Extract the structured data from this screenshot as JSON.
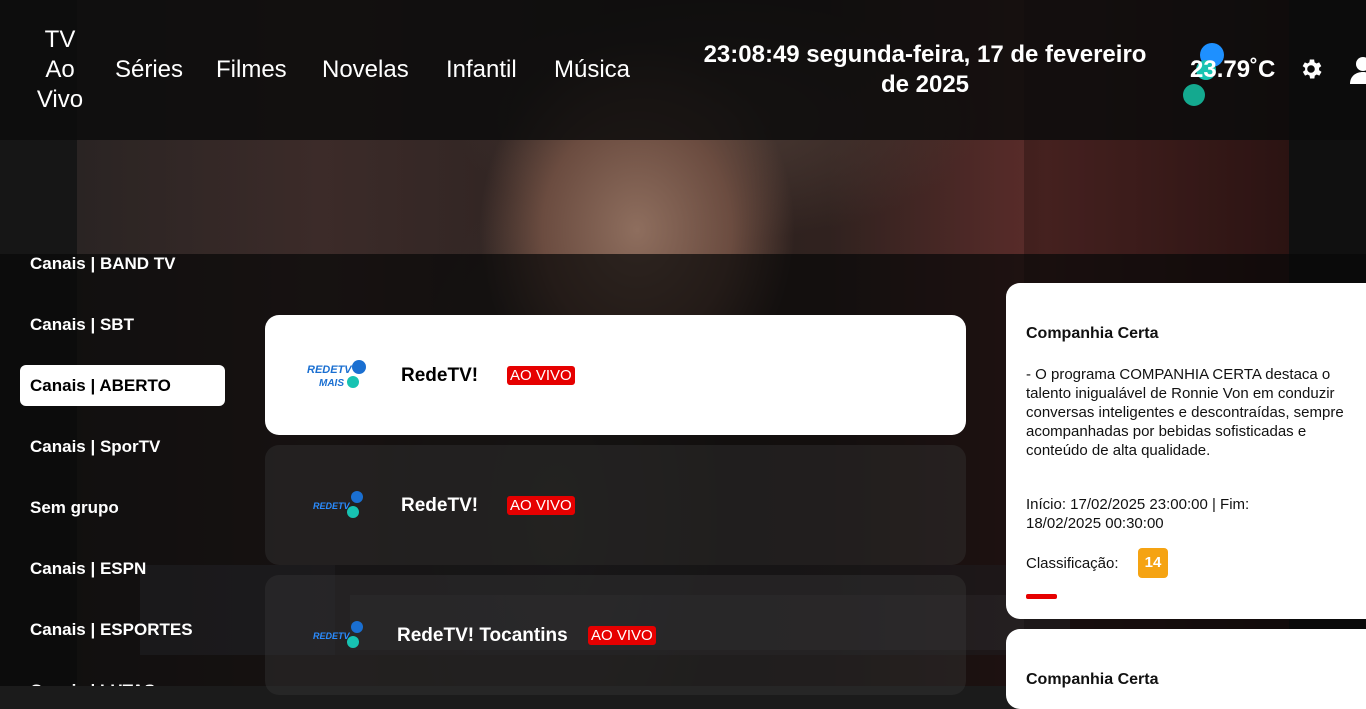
{
  "nav": {
    "tv_ao_vivo": [
      "TV",
      "Ao",
      "Vivo"
    ],
    "series": "Séries",
    "filmes": "Filmes",
    "novelas": "Novelas",
    "infantil": "Infantil",
    "musica": "Música"
  },
  "clock": {
    "line1": "23:08:49 segunda-feira, 17 de fevereiro",
    "line2": "de 2025"
  },
  "weather": {
    "temperature": "23.79˚C",
    "icon": "weather-icon"
  },
  "header_icons": [
    "gear-icon",
    "user-icon"
  ],
  "groups": [
    {
      "label": "Canais | BAND TV",
      "active": false
    },
    {
      "label": "Canais | SBT",
      "active": false
    },
    {
      "label": "Canais | ABERTO",
      "active": true
    },
    {
      "label": "Canais | SporTV",
      "active": false
    },
    {
      "label": "Sem grupo",
      "active": false
    },
    {
      "label": "Canais | ESPN",
      "active": false
    },
    {
      "label": "Canais | ESPORTES",
      "active": false
    },
    {
      "label": "Canais | LUTAS",
      "active": false
    }
  ],
  "channels": [
    {
      "name": "RedeTV!",
      "badge": "AO VIVO",
      "logo": "redetv-mais-logo",
      "selected": true
    },
    {
      "name": "RedeTV!",
      "badge": "AO VIVO",
      "logo": "redetv-logo",
      "selected": false
    },
    {
      "name": "RedeTV! Tocantins",
      "badge": "AO VIVO",
      "logo": "redetv-logo",
      "selected": false
    }
  ],
  "program": {
    "title": "Companhia Certa",
    "description": "- O programa COMPANHIA CERTA destaca o talento inigualável de Ronnie Von em conduzir conversas inteligentes e descontraídas, sempre acompanhadas por bebidas sofisticadas e conteúdo de alta qualidade.",
    "times": "Início: 17/02/2025 23:00:00 | Fim: 18/02/2025 00:30:00",
    "rating_label": "Classificação:",
    "rating": "14",
    "progress": 0.09
  },
  "next_program": {
    "title": "Companhia Certa"
  },
  "colors": {
    "live_badge": "#e60000",
    "rating_badge": "#f5a312",
    "progress": "#e60000"
  }
}
